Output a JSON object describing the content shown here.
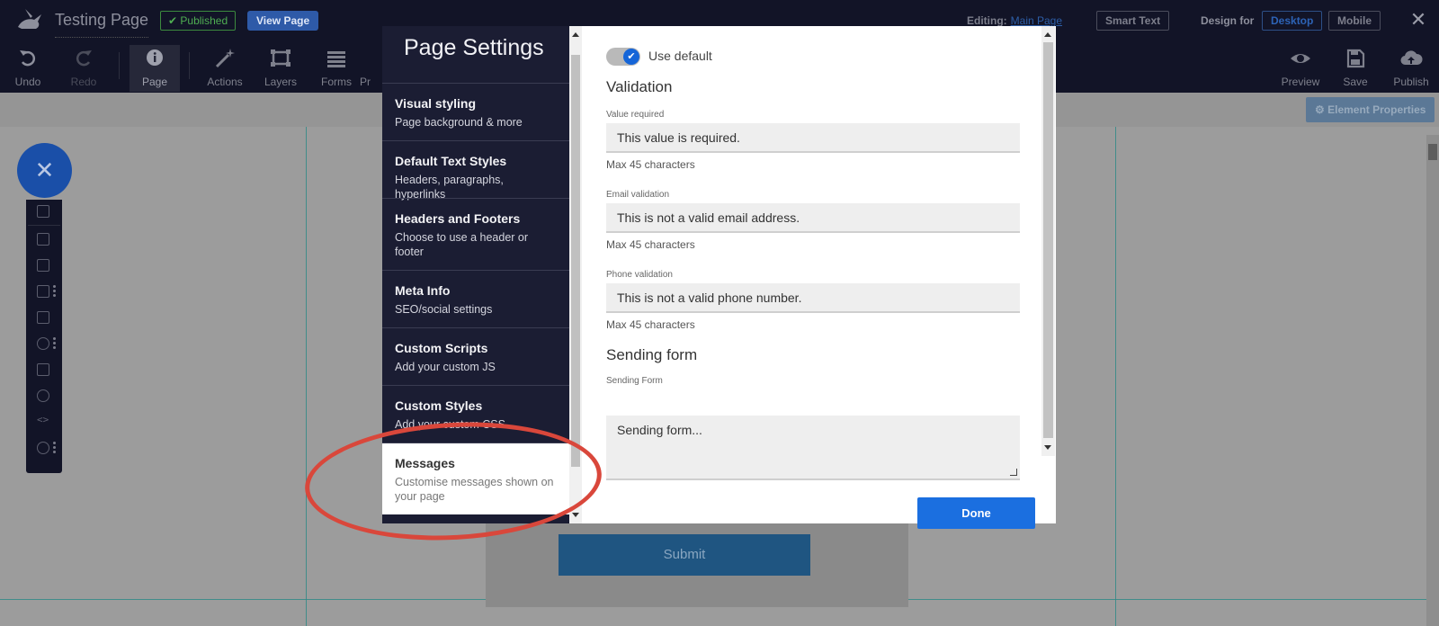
{
  "topbar": {
    "page_title": "Testing Page",
    "published_label": "Published",
    "view_page_label": "View Page",
    "editing_label": "Editing:",
    "editing_target": "Main Page",
    "smart_text_label": "Smart Text",
    "design_for_label": "Design for",
    "desktop_label": "Desktop",
    "mobile_label": "Mobile"
  },
  "toolbar": {
    "undo": "Undo",
    "redo": "Redo",
    "page": "Page",
    "actions": "Actions",
    "layers": "Layers",
    "forms": "Forms",
    "pr": "Pr",
    "preview": "Preview",
    "save": "Save",
    "publish": "Publish"
  },
  "canvas": {
    "element_properties_label": "Element Properties",
    "submit_label": "Submit"
  },
  "modal": {
    "title": "Page Settings",
    "nav_items": [
      {
        "title": "Visual styling",
        "subtitle": "Page background & more"
      },
      {
        "title": "Default Text Styles",
        "subtitle": "Headers, paragraphs, hyperlinks"
      },
      {
        "title": "Headers and Footers",
        "subtitle": "Choose to use a header or footer"
      },
      {
        "title": "Meta Info",
        "subtitle": "SEO/social settings"
      },
      {
        "title": "Custom Scripts",
        "subtitle": "Add your custom JS"
      },
      {
        "title": "Custom Styles",
        "subtitle": "Add your custom CSS"
      },
      {
        "title": "Messages",
        "subtitle": "Customise messages shown on your page"
      }
    ],
    "use_default_label": "Use default",
    "validation_heading": "Validation",
    "value_required_label": "Value required",
    "value_required_value": "This value is required.",
    "email_validation_label": "Email validation",
    "email_validation_value": "This is not a valid email address.",
    "phone_validation_label": "Phone validation",
    "phone_validation_value": "This is not a valid phone number.",
    "max_chars_hint": "Max 45 characters",
    "sending_form_heading": "Sending form",
    "sending_form_label": "Sending Form",
    "sending_form_value": "Sending form...",
    "done_label": "Done"
  },
  "colors": {
    "topbar_bg": "#121427",
    "modal_nav_bg": "#1b1d33",
    "primary_blue": "#1b6fe0",
    "annotation_red": "#d9473b"
  }
}
